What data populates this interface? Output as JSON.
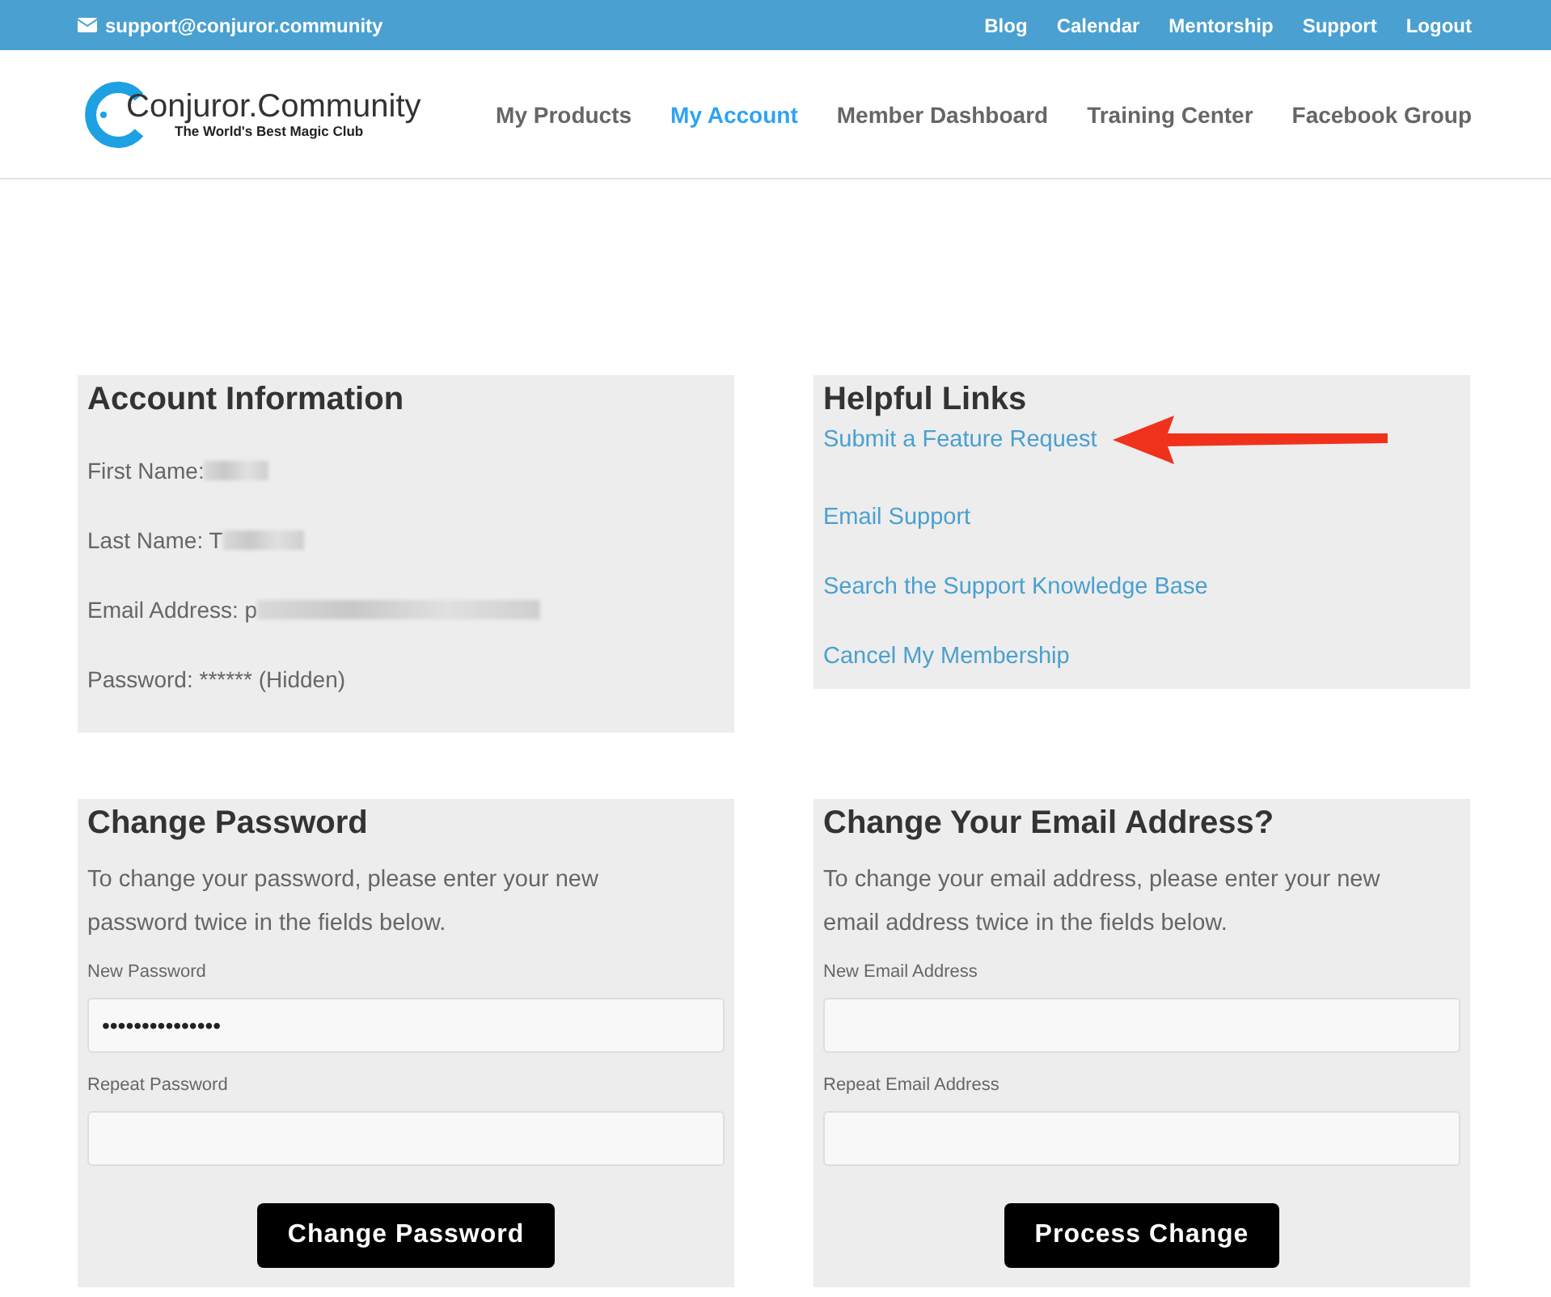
{
  "top_bar": {
    "email": "support@conjuror.community",
    "links": [
      "Blog",
      "Calendar",
      "Mentorship",
      "Support",
      "Logout"
    ]
  },
  "header": {
    "logo": {
      "name": "Conjuror.Community",
      "tagline": "The World's Best Magic Club"
    },
    "nav": [
      {
        "label": "My Products",
        "selected": false
      },
      {
        "label": "My Account",
        "selected": true
      },
      {
        "label": "Member Dashboard",
        "selected": false
      },
      {
        "label": "Training Center",
        "selected": false
      },
      {
        "label": "Facebook Group",
        "selected": false
      }
    ]
  },
  "account_information": {
    "title": "Account Information",
    "fields": [
      {
        "label": "First Name: ",
        "redacted": true
      },
      {
        "label": "Last Name: T",
        "redacted": true
      },
      {
        "label": "Email Address: p",
        "redacted": true
      },
      {
        "label": "Password: ****** (Hidden)",
        "redacted": false
      }
    ]
  },
  "helpful_links": {
    "title": "Helpful Links",
    "links": [
      {
        "label": "Submit a Feature Request",
        "highlighted": true
      },
      {
        "label": "Email Support",
        "highlighted": false
      },
      {
        "label": "Search the Support Knowledge Base",
        "highlighted": false
      },
      {
        "label": "Cancel My Membership",
        "highlighted": false
      }
    ]
  },
  "change_password": {
    "title": "Change Password",
    "description": "To change your password, please enter your new password twice in the fields below.",
    "fields": [
      {
        "label": "New Password",
        "value": "•••••••••••••••"
      },
      {
        "label": "Repeat Password"
      }
    ],
    "button": "Change Password"
  },
  "change_email": {
    "title": "Change Your Email Address?",
    "description": "To change your email address, please enter your new email address twice in the fields below.",
    "fields": [
      {
        "label": "New Email Address"
      },
      {
        "label": "Repeat Email Address"
      }
    ],
    "button": "Process Change"
  }
}
